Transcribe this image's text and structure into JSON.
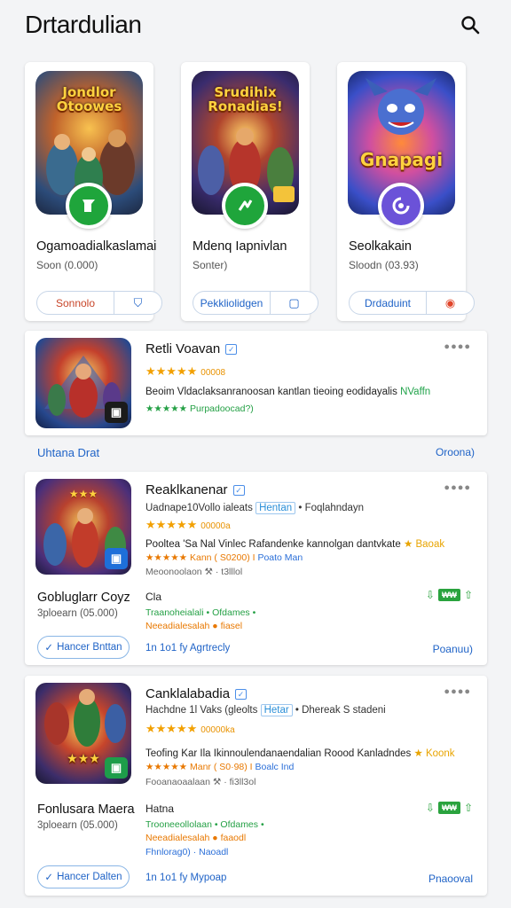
{
  "header": {
    "title": "Drtardulian"
  },
  "featured": [
    {
      "art_title": "Jondlor Otoowes",
      "name": "Ogamoadialkaslamai",
      "sub": "Soon (0.000)",
      "button": "Sonnolo",
      "btn_icon": "⛉"
    },
    {
      "art_title": "Srudihix Ronadias!",
      "name": "Mdenq Iapnivlan",
      "sub": "Sonter)",
      "button": "Pekkliolidgen",
      "btn_icon": "▢"
    },
    {
      "art_title": "Gnapagi",
      "name": "Seolkakain",
      "sub": "Sloodn (03.93)",
      "button": "Drdaduint",
      "btn_icon": "◉"
    }
  ],
  "list1": {
    "title": "Retli Voavan",
    "stars": "★★★★★",
    "rating": "00008",
    "desc": "Beoim Vldaclaksanranoosan kantlan tieoing eodidayalis",
    "desc_green": "NVaffn",
    "line2": "★★★★★ Purpadoocad?)"
  },
  "section": {
    "label": "Uhtana Drat",
    "link": "Oroona)"
  },
  "list2": {
    "title": "Reaklkanenar",
    "meta": "Uadnape10Vollo ialeats",
    "meta_tag": "Hentan",
    "meta_tail": "Foqlahndayn",
    "stars": "★★★★★",
    "rating": "00000a",
    "desc": "Pooltea 'Sa Nal Vinlec Rafandenke kannolgan dantvkate",
    "desc_green": "★ Baoak",
    "line2a": "★★★★★ Kann ( S0200) I",
    "line2b": "Poato Man",
    "line3": "Meoonoolaon  ⚒ · t3lllol",
    "left_name": "Gobluglarr Coyz",
    "left_sub": "3ploearn (05.000)",
    "mid_word": "Cla",
    "mid_line1": "Traanoheialali  •  Ofdames •",
    "mid_line2": "Neeadialesalah  ●  fiasel",
    "button": "Hancer Bnttan",
    "bottom_text": "1n 1o1 fy Agrtrecly",
    "price": "₩₩",
    "right_link": "Poanuu)"
  },
  "list3": {
    "title": "Canklalabadia",
    "meta": "Hachdne 1l Vaks (gleolts",
    "meta_tag": "Hetar",
    "meta_tail": "Dhereak S stadeni",
    "stars": "★★★★★",
    "rating": "00000ka",
    "desc": "Teofing Kar Ila Ikinnoulendanaendalian Roood Kanladndes",
    "desc_green": "★ Koonk",
    "line2a": "★★★★★ Manr ( S0·98) I",
    "line2b": "Boalc Ind",
    "line3": "Fooanaoaalaan  ⚒ · fi3ll3ol",
    "left_name": "Fonlusara Maera",
    "left_sub": "3ploearn (05.000)",
    "mid_word": "Hatna",
    "mid_line1": "Trooneeollolaan  •  Ofdames •",
    "mid_line2": "Neeadialesalah  ●  faaodl",
    "mid_line3": "Fhnlorag0)  ·  Naoadl",
    "button": "Hancer Dalten",
    "bottom_text": "1n 1o1 fy Mypoap",
    "price": "₩₩",
    "right_link": "Pnaooval"
  },
  "colors": {
    "accent": "#1f63c7",
    "star": "#f2a000",
    "green": "#2aa33e"
  }
}
